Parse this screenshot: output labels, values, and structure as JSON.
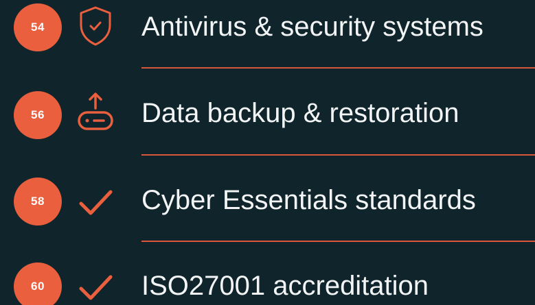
{
  "items": [
    {
      "number": "54",
      "label": "Antivirus & security systems",
      "icon": "shield-check-icon"
    },
    {
      "number": "56",
      "label": "Data backup & restoration",
      "icon": "drive-upload-icon"
    },
    {
      "number": "58",
      "label": "Cyber Essentials standards",
      "icon": "checkmark-icon"
    },
    {
      "number": "60",
      "label": "ISO27001 accreditation",
      "icon": "checkmark-icon"
    }
  ],
  "colors": {
    "background": "#0f252b",
    "accent": "#ea5f3e",
    "text": "#f2f4f5"
  }
}
